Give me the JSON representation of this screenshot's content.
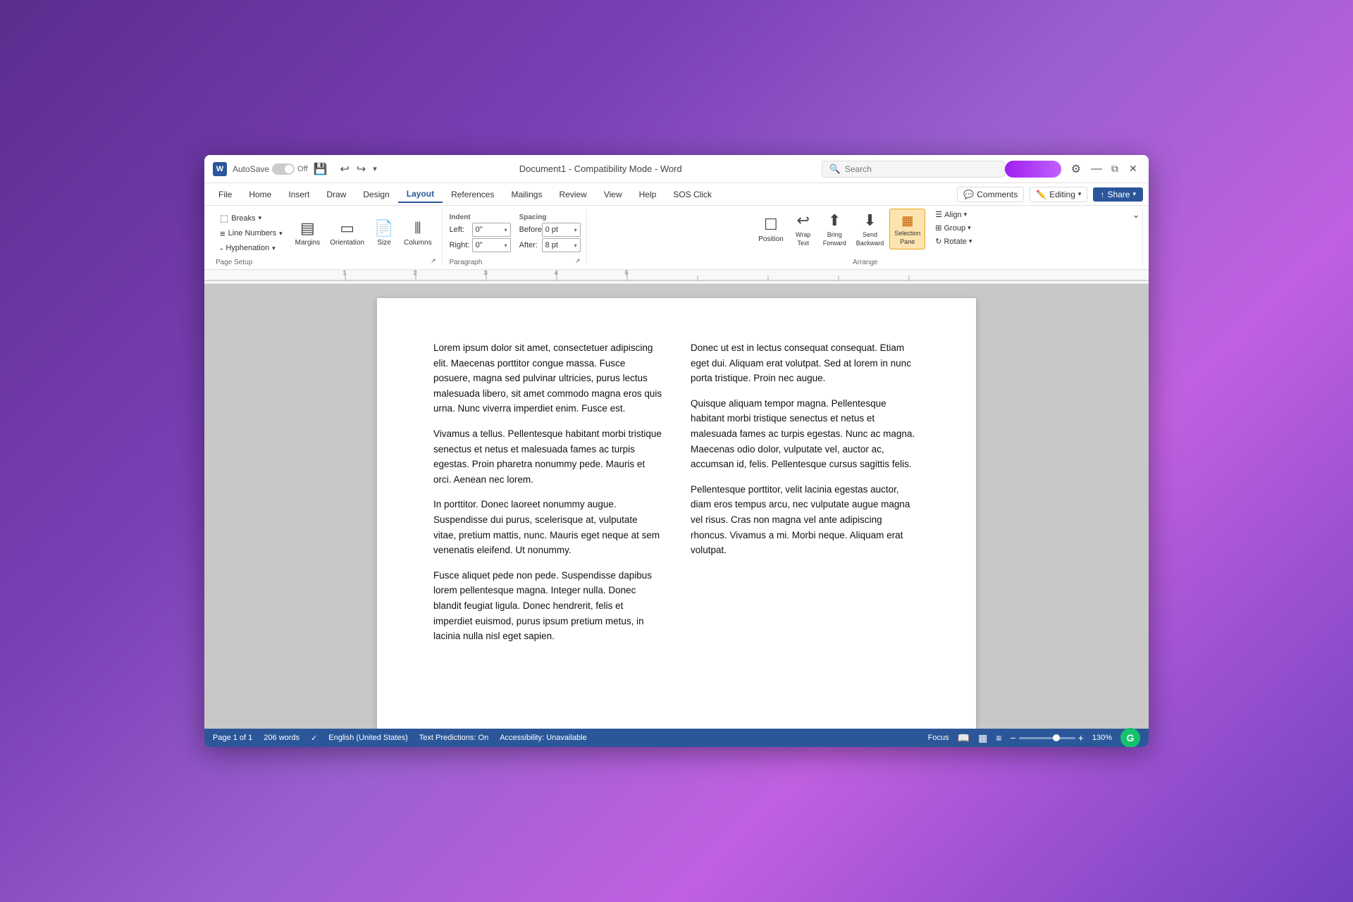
{
  "titlebar": {
    "app_icon": "W",
    "autosave_label": "AutoSave",
    "toggle_state": "Off",
    "save_icon": "💾",
    "undo_icon": "↩",
    "redo_icon": "↪",
    "more_icon": "▾",
    "doc_title": "Document1  -  Compatibility Mode  -  Word",
    "search_placeholder": "Search",
    "profile_area": "",
    "settings_icon": "⚙",
    "minimize_label": "—",
    "restore_label": "⧉",
    "close_label": "✕"
  },
  "ribbon": {
    "tabs": [
      "File",
      "Home",
      "Insert",
      "Draw",
      "Design",
      "Layout",
      "References",
      "Mailings",
      "Review",
      "View",
      "Help",
      "SOS Click"
    ],
    "active_tab": "Layout",
    "comments_label": "Comments",
    "editing_label": "Editing",
    "share_label": "Share",
    "groups": {
      "page_setup": {
        "label": "Page Setup",
        "buttons": [
          {
            "id": "margins",
            "label": "Margins",
            "icon": "▤"
          },
          {
            "id": "orientation",
            "label": "Orientation",
            "icon": "▭"
          },
          {
            "id": "size",
            "label": "Size",
            "icon": "📄"
          },
          {
            "id": "columns",
            "label": "Columns",
            "icon": "⫴"
          }
        ],
        "line_numbers_label": "Line Numbers",
        "breaks_label": "Breaks",
        "hyphenation_label": "Hyphenation"
      },
      "paragraph": {
        "label": "Paragraph",
        "indent_label": "Indent",
        "spacing_label": "Spacing",
        "left_label": "Left:",
        "right_label": "Right:",
        "before_label": "Before:",
        "after_label": "After:",
        "left_value": "0\"",
        "right_value": "0\"",
        "before_value": "0 pt",
        "after_value": "8 pt"
      },
      "arrange": {
        "label": "Arrange",
        "position_label": "Position",
        "wrap_text_label": "Wrap Text",
        "bring_forward_label": "Bring Forward",
        "send_backward_label": "Send Backward",
        "selection_pane_label": "Selection Pane",
        "align_label": "Align",
        "group_label": "Group",
        "rotate_label": "Rotate"
      }
    }
  },
  "document": {
    "paragraphs": [
      "Lorem ipsum dolor sit amet, consectetuer adipiscing elit. Maecenas porttitor congue massa. Fusce posuere, magna sed pulvinar ultricies, purus lectus malesuada libero, sit amet commodo magna eros quis urna. Nunc viverra imperdiet enim. Fusce est.",
      "Vivamus a tellus. Pellentesque habitant morbi tristique senectus et netus et malesuada fames ac turpis egestas. Proin pharetra nonummy pede. Mauris et orci. Aenean nec lorem.",
      "In porttitor. Donec laoreet nonummy augue. Suspendisse dui purus, scelerisque at, vulputate vitae, pretium mattis, nunc. Mauris eget neque at sem venenatis eleifend. Ut nonummy.",
      "Fusce aliquet pede non pede. Suspendisse dapibus lorem pellentesque magna. Integer nulla. Donec blandit feugiat ligula. Donec hendrerit, felis et imperdiet euismod, purus ipsum pretium metus, in lacinia nulla nisl eget sapien.",
      "Donec ut est in lectus consequat consequat. Etiam eget dui. Aliquam erat volutpat. Sed at lorem in nunc porta tristique. Proin nec augue.",
      "Quisque aliquam tempor magna. Pellentesque habitant morbi tristique senectus et netus et malesuada fames ac turpis egestas. Nunc ac magna. Maecenas odio dolor, vulputate vel, auctor ac, accumsan id, felis. Pellentesque cursus sagittis felis.",
      "Pellentesque porttitor, velit lacinia egestas auctor, diam eros tempus arcu, nec vulputate augue magna vel risus. Cras non magna vel ante adipiscing rhoncus. Vivamus a mi. Morbi neque. Aliquam erat volutpat."
    ]
  },
  "statusbar": {
    "page_info": "Page 1 of 1",
    "word_count": "206 words",
    "track_changes_icon": "✓",
    "language": "English (United States)",
    "text_predictions": "Text Predictions: On",
    "accessibility": "Accessibility: Unavailable",
    "focus_label": "Focus",
    "zoom_value": "130%",
    "view_buttons": [
      "📖",
      "▦",
      "≡"
    ]
  }
}
